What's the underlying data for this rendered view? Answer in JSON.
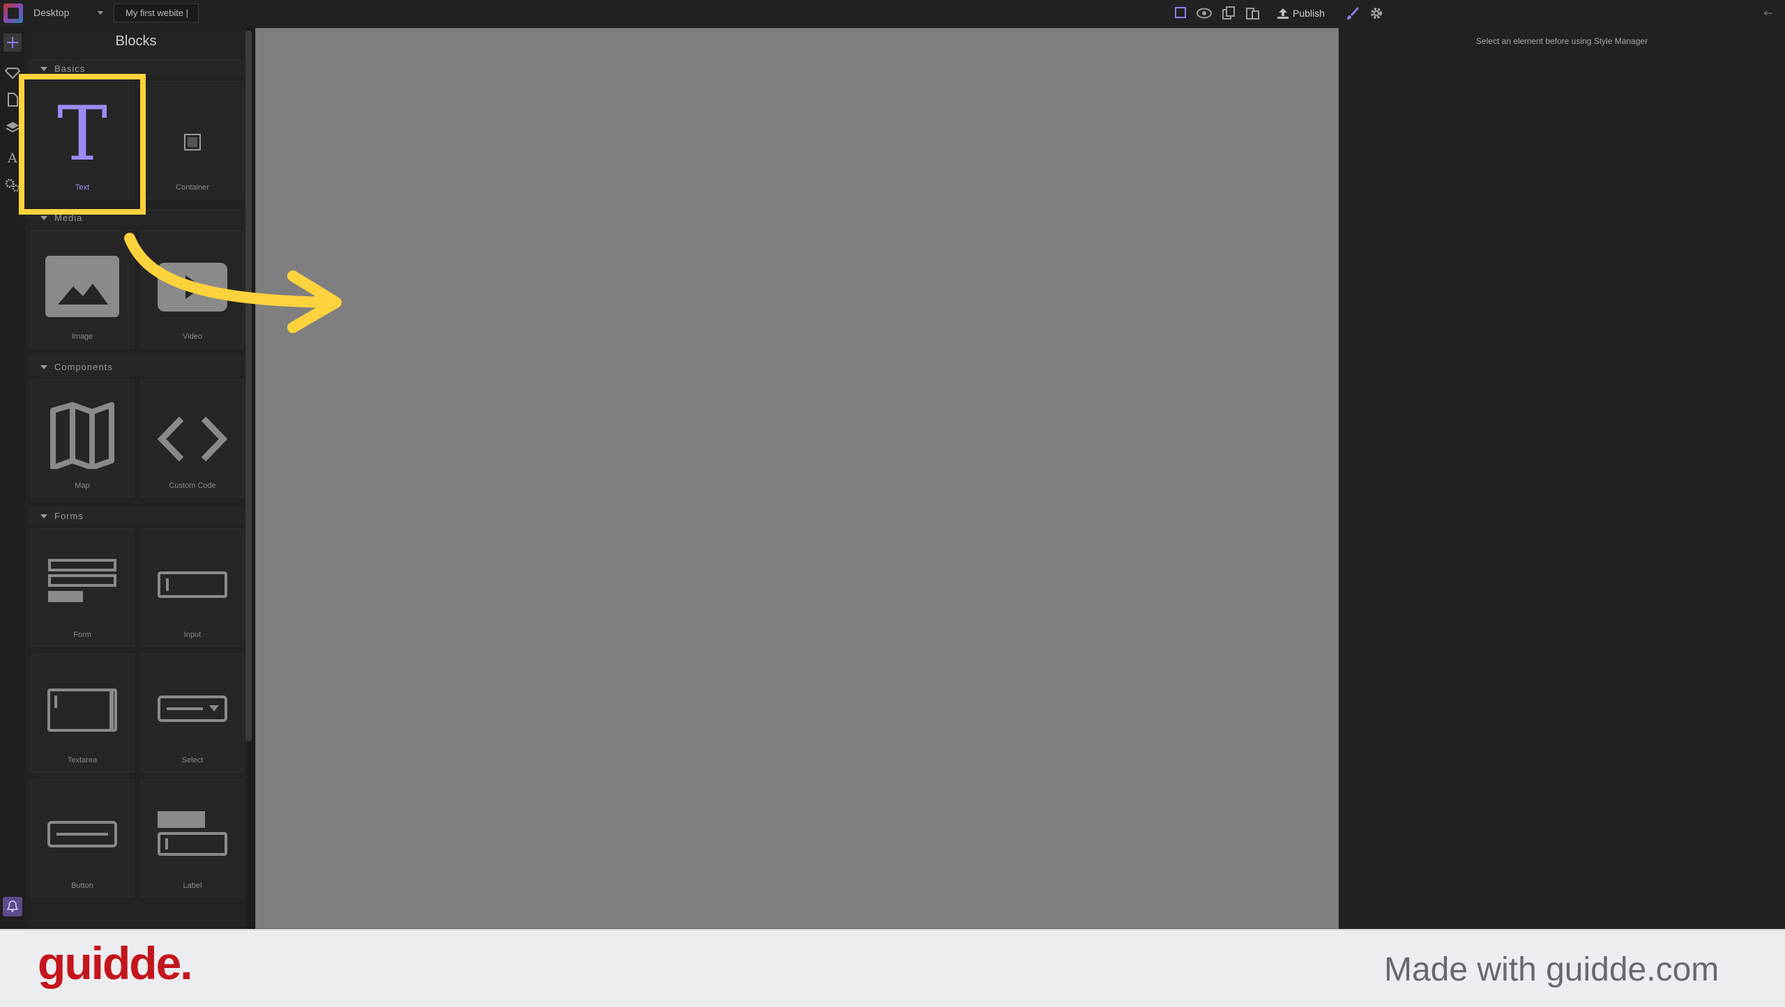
{
  "topbar": {
    "device": "Desktop",
    "site_title": "My first webite |",
    "publish_label": "Publish"
  },
  "blocks_panel": {
    "title": "Blocks",
    "categories": [
      {
        "name": "Basics",
        "blocks": [
          "Text",
          "Container"
        ]
      },
      {
        "name": "Media",
        "blocks": [
          "Image",
          "Video"
        ]
      },
      {
        "name": "Components",
        "blocks": [
          "Map",
          "Custom Code"
        ]
      },
      {
        "name": "Forms",
        "blocks": [
          "Form",
          "Input",
          "Textarea",
          "Select",
          "Button",
          "Label"
        ]
      }
    ]
  },
  "style_manager": {
    "message": "Select an element before using Style Manager"
  },
  "footer": {
    "brand": "guidde.",
    "tagline": "Made with guidde.com"
  },
  "colors": {
    "highlight": "#fdd33d",
    "accent": "#9b8cf5",
    "brand": "#c4151c"
  }
}
